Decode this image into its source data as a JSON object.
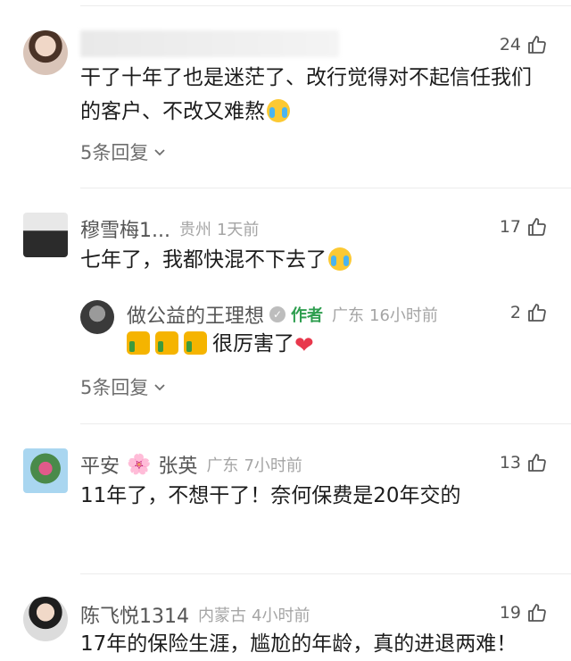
{
  "comments": [
    {
      "name": "",
      "likes": "24",
      "text_line1": "干了十年了也是迷茫了、改行觉得对不起信任我们",
      "text_line2": "的客户、不改又难熬",
      "emoji": "loudly-crying-face",
      "replies_label": "5条回复"
    },
    {
      "name": "穆雪梅1...",
      "location": "贵州",
      "time": "1天前",
      "likes": "17",
      "text": "七年了，我都快混不下去了",
      "emoji": "loudly-crying-face",
      "reply": {
        "name": "做公益的王理想",
        "author_tag": "作者",
        "location": "广东",
        "time": "16小时前",
        "likes": "2",
        "text": "很厉害了",
        "emojis": [
          "thumbs-up",
          "thumbs-up",
          "thumbs-up",
          "red-heart"
        ]
      },
      "replies_label": "5条回复"
    },
    {
      "name": "平安",
      "name_emoji": "🌸",
      "name_suffix": "张英",
      "location": "广东",
      "time": "7小时前",
      "likes": "13",
      "text": "11年了，不想干了！奈何保费是20年交的"
    },
    {
      "name": "陈飞悦1314",
      "location": "内蒙古",
      "time": "4小时前",
      "likes": "19",
      "text": "17年的保险生涯，尴尬的年龄，真的进退两难！"
    }
  ],
  "colors": {
    "author_tag": "#2e9e4f",
    "meta_gray": "#a5a5a5",
    "heart_red": "#e8384c"
  },
  "icons": {
    "like": "thumbs-up-outline-icon",
    "expand": "chevron-down-icon",
    "verified": "verified-badge-icon"
  }
}
